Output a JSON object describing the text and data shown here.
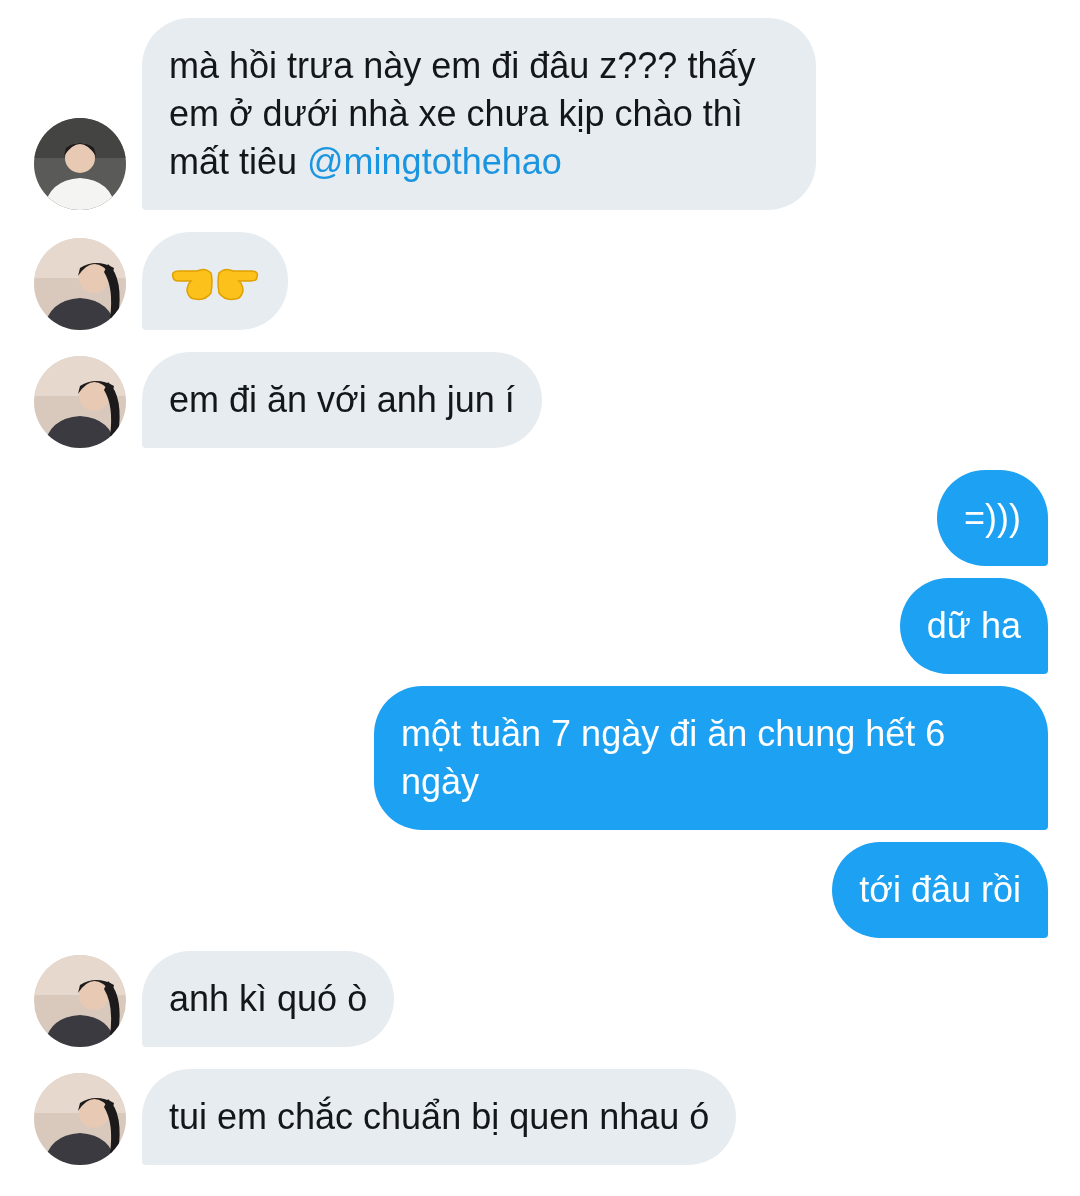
{
  "messages": [
    {
      "sent": false,
      "kind": "text",
      "parts": [
        {
          "kind": "plain",
          "text": "mà hồi trưa này em đi đâu z??? thấy em ở dưới nhà xe chưa kịp chào thì mất tiêu "
        },
        {
          "kind": "mention",
          "text": "@mingtothehao"
        }
      ]
    },
    {
      "sent": false,
      "kind": "emoji"
    },
    {
      "sent": false,
      "kind": "text",
      "parts": [
        {
          "kind": "plain",
          "text": "em đi ăn với anh jun í"
        }
      ]
    },
    {
      "sent": true,
      "kind": "text",
      "parts": [
        {
          "kind": "plain",
          "text": "=)))"
        }
      ]
    },
    {
      "sent": true,
      "kind": "text",
      "parts": [
        {
          "kind": "plain",
          "text": "dữ ha"
        }
      ]
    },
    {
      "sent": true,
      "kind": "text",
      "parts": [
        {
          "kind": "plain",
          "text": "một tuần 7 ngày đi ăn chung hết 6 ngày"
        }
      ]
    },
    {
      "sent": true,
      "kind": "text",
      "parts": [
        {
          "kind": "plain",
          "text": "tới đâu rồi"
        }
      ]
    },
    {
      "sent": false,
      "kind": "text",
      "parts": [
        {
          "kind": "plain",
          "text": "anh kì quó ò"
        }
      ]
    },
    {
      "sent": false,
      "kind": "text",
      "parts": [
        {
          "kind": "plain",
          "text": "tui em chắc chuẩn bị quen nhau ó"
        }
      ]
    }
  ]
}
